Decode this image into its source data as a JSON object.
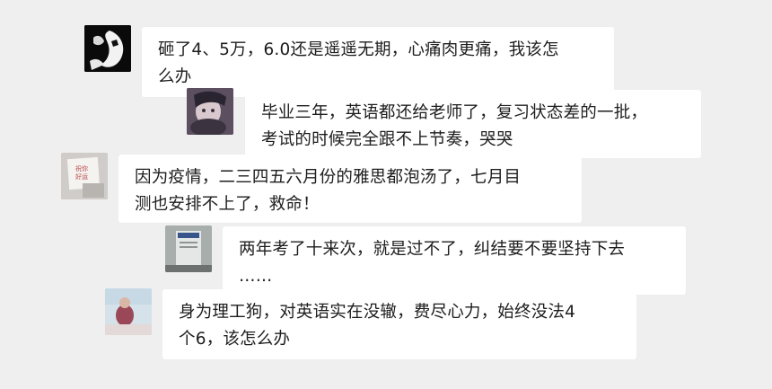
{
  "messages": [
    {
      "avatar": "black-and-white-sketch-avatar",
      "text": "砸了4、5万，6.0还是遥遥无期，心痛肉更痛，我该怎\n么办"
    },
    {
      "avatar": "dark-portrait-avatar",
      "text": "毕业三年，英语都还给老师了，复习状态差的一批，\n考试的时候完全跟不上节奏，哭哭"
    },
    {
      "avatar": "note-card-avatar",
      "avatar_text": "祝你\n好运",
      "text": "因为疫情，二三四五六月份的雅思都泡汤了，七月目\n测也安排不上了，救命！"
    },
    {
      "avatar": "door-sign-avatar",
      "text": "两年考了十来次，就是过不了，纠结要不要坚持下去\n……"
    },
    {
      "avatar": "photo-avatar",
      "text": "身为理工狗，对英语实在没辙，费尽心力，始终没法4\n个6，该怎么办"
    }
  ],
  "colors": {
    "background": "#efefef",
    "bubble": "#ffffff",
    "text": "#1d1d1d"
  }
}
